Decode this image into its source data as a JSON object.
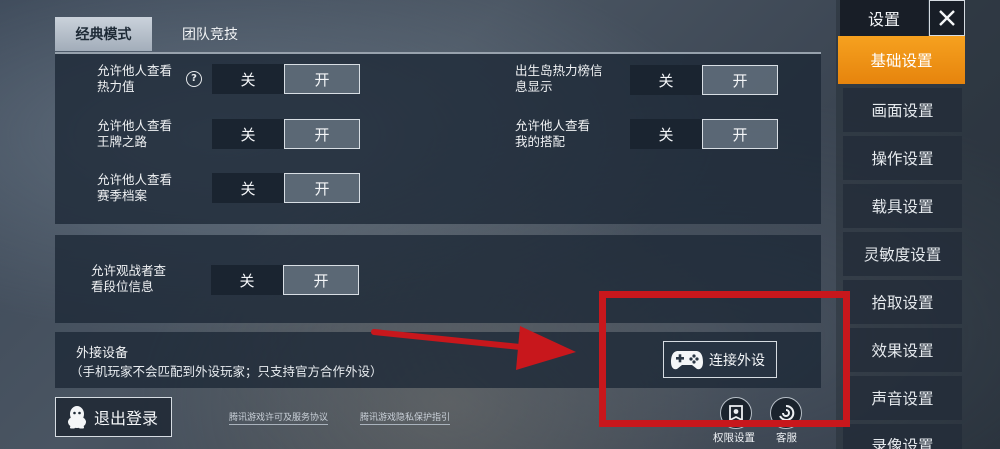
{
  "tabs": [
    {
      "label": "经典模式",
      "active": true
    },
    {
      "label": "团队竞技",
      "active": false
    }
  ],
  "privacy_options": [
    {
      "label": "允许他人查看\n热力值",
      "has_help": true,
      "off_label": "关",
      "on_label": "开",
      "selected": "on"
    },
    {
      "label": "允许他人查看\n王牌之路",
      "has_help": false,
      "off_label": "关",
      "on_label": "开",
      "selected": "on"
    },
    {
      "label": "允许他人查看\n赛季档案",
      "has_help": false,
      "off_label": "关",
      "on_label": "开",
      "selected": "on"
    },
    {
      "label": "出生岛热力榜信\n息显示",
      "has_help": false,
      "off_label": "关",
      "on_label": "开",
      "selected": "on"
    },
    {
      "label": "允许他人查看\n我的搭配",
      "has_help": false,
      "off_label": "关",
      "on_label": "开",
      "selected": "on"
    }
  ],
  "help_glyph": "?",
  "spectator_option": {
    "label": "允许观战者查\n看段位信息",
    "off_label": "关",
    "on_label": "开",
    "selected": "on"
  },
  "external_device": {
    "title": "外接设备",
    "subtitle": "（手机玩家不会匹配到外设玩家；只支持官方合作外设）",
    "connect_label": "连接外设",
    "connect_icon": "gamepad-icon"
  },
  "footer": {
    "logout_label": "退出登录",
    "logout_icon": "qq-penguin-icon",
    "license_link": "腾讯游戏许可及服务协议",
    "privacy_link": "腾讯游戏隐私保护指引",
    "permission_label": "权限设置",
    "permission_icon": "permission-icon",
    "support_label": "客服",
    "support_icon": "support-icon"
  },
  "sidebar": {
    "title": "设置",
    "close_icon": "close-icon",
    "items": [
      {
        "label": "基础设置",
        "active": true
      },
      {
        "label": "画面设置",
        "active": false
      },
      {
        "label": "操作设置",
        "active": false
      },
      {
        "label": "载具设置",
        "active": false
      },
      {
        "label": "灵敏度设置",
        "active": false
      },
      {
        "label": "拾取设置",
        "active": false
      },
      {
        "label": "效果设置",
        "active": false
      },
      {
        "label": "声音设置",
        "active": false
      },
      {
        "label": "录像设置",
        "active": false
      }
    ]
  },
  "colors": {
    "accent": "#f09418",
    "annotation_red": "#c8171c",
    "panel": "#1c2836"
  }
}
